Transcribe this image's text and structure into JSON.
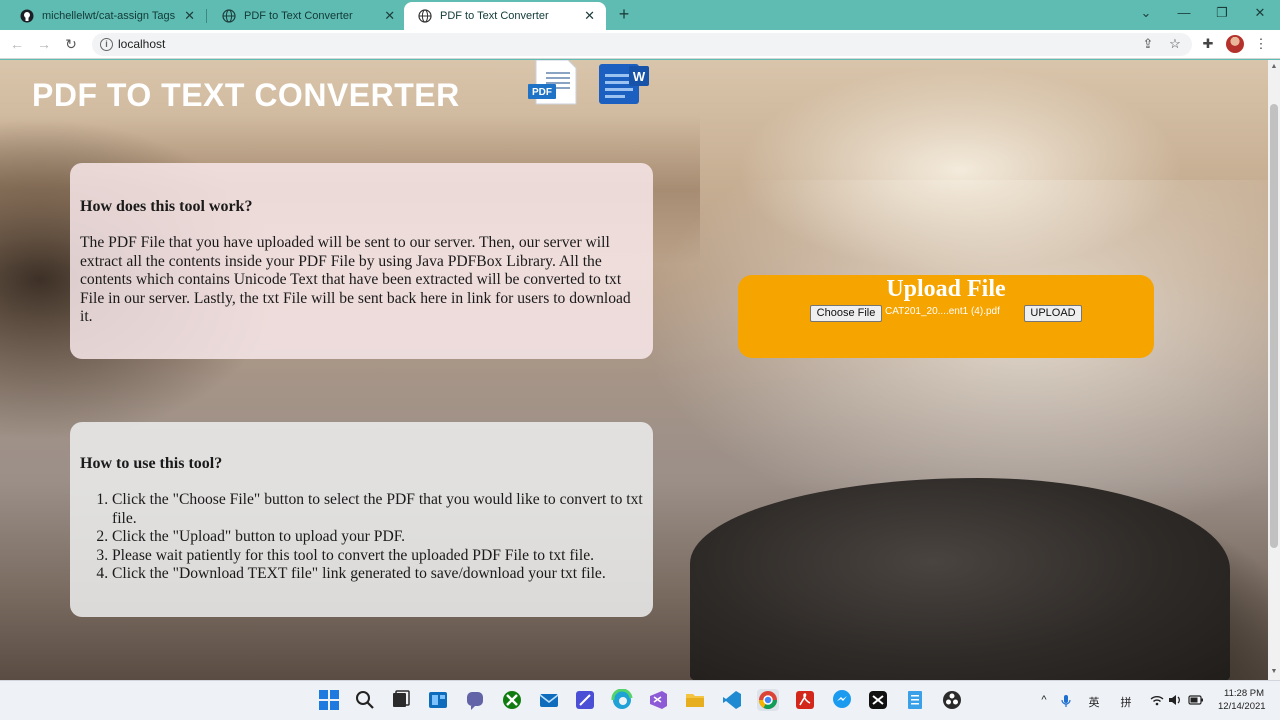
{
  "browser": {
    "tabs": [
      {
        "label": "michellelwt/cat-assign Tags | Doc",
        "close": "✕",
        "active": false
      },
      {
        "label": "PDF to Text Converter",
        "close": "✕",
        "active": false
      },
      {
        "label": "PDF to Text Converter",
        "close": "✕",
        "active": true
      }
    ],
    "new_tab": "+",
    "window_controls": {
      "chevron": "⌄",
      "minimize": "—",
      "maximize": "❐",
      "close": "✕"
    },
    "back": "←",
    "forward": "→",
    "reload": "↻",
    "info": "i",
    "url": "localhost",
    "toolbar_icons": {
      "share": "⇪",
      "star": "☆",
      "extensions": "✚",
      "menu": "⋮"
    }
  },
  "page": {
    "title": "PDF TO TEXT CONVERTER",
    "logos": {
      "pdf_text": "PDF",
      "word_text": "W"
    },
    "how_it_works": {
      "heading": "How does this tool work?",
      "body": "The PDF File that you have uploaded will be sent to our server. Then, our server will extract all the contents inside your PDF File by using Java PDFBox Library. All the contents which contains Unicode Text that have been extracted will be converted to txt File in our server. Lastly, the txt File will be sent back here in link for users to download it."
    },
    "how_to_use": {
      "heading": "How to use this tool?",
      "steps": [
        "Click the \"Choose File\" button to select the PDF that you would like to convert to txt file.",
        "Click the \"Upload\" button to upload your PDF.",
        "Please wait patiently for this tool to convert the uploaded PDF File to txt file.",
        "Click the \"Download TEXT file\" link generated to save/download your txt file."
      ]
    },
    "upload": {
      "heading": "Upload File",
      "choose_label": "Choose File",
      "file_name": "CAT201_20....ent1 (4).pdf",
      "upload_label": "UPLOAD"
    }
  },
  "taskbar": {
    "tray": {
      "chevron": "^",
      "mic": "🎤",
      "ime_lang": "英",
      "ime_mode": "拼"
    },
    "time": "11:28 PM",
    "date": "12/14/2021"
  },
  "colors": {
    "accent_upload": "#f6a400",
    "browser_frame": "#5fbcb3"
  }
}
